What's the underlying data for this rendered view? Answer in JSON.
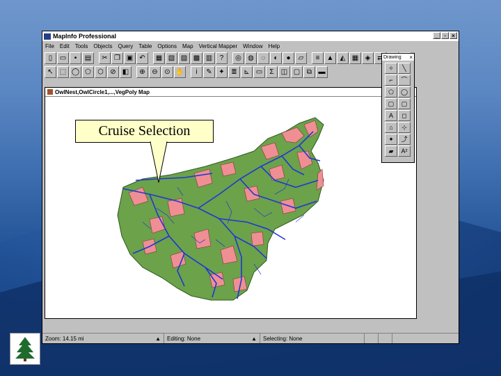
{
  "app": {
    "title": "MapInfo Professional",
    "window_controls": [
      "_",
      "▫",
      "×"
    ]
  },
  "menubar": {
    "items": [
      "File",
      "Edit",
      "Tools",
      "Objects",
      "Query",
      "Table",
      "Options",
      "Map",
      "Vertical Mapper",
      "Window",
      "Help"
    ]
  },
  "map_window": {
    "title": "OwlNest,OwlCircle1,...,VegPoly Map",
    "window_controls": [
      "_",
      "▫",
      "×"
    ]
  },
  "callout": {
    "text": "Cruise Selection"
  },
  "drawing_palette": {
    "title": "Drawing",
    "close": "×"
  },
  "statusbar": {
    "zoom": "Zoom: 14.15 mi",
    "editing": "Editing: None",
    "selecting": "Selecting: None"
  },
  "colors": {
    "vegetation_green": "#6ba24a",
    "selection_pink": "#ef8f93",
    "stream_blue": "#1f36d8",
    "callout_fill": "#ffffc8"
  }
}
